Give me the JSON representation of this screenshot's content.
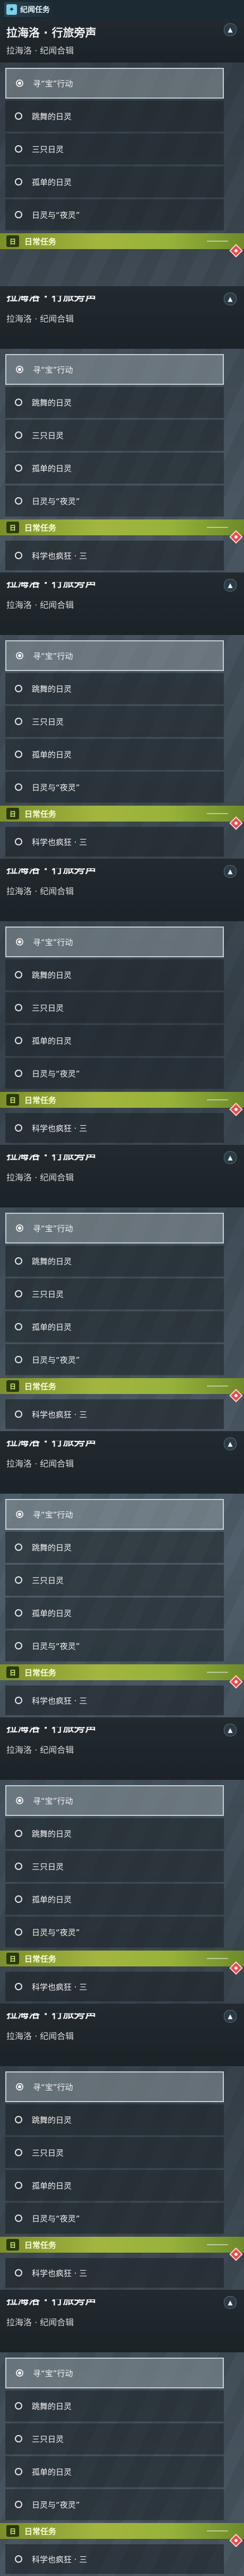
{
  "category": {
    "label": "纪闻任务"
  },
  "quest": {
    "title": "拉海洛 · 行旅旁声",
    "subtitle": "拉海洛 · 纪闻合辑"
  },
  "steps": [
    {
      "label": "寻“宝”行动",
      "active": true
    },
    {
      "label": "跳舞的日灵",
      "active": false
    },
    {
      "label": "三只日灵",
      "active": false
    },
    {
      "label": "孤单的日灵",
      "active": false
    },
    {
      "label": "日灵与“夜灵”",
      "active": false
    }
  ],
  "daily": {
    "label": "日常任务",
    "item": "科学也疯狂 · 三"
  },
  "icons": {
    "category": "plus-icon",
    "collapse": "chevron-up-icon",
    "daily": "daily-icon",
    "alert": "alert-diamond-icon"
  },
  "colors": {
    "topbar": "#1c2a33",
    "category_icon": "#7ed0e8",
    "daily_bar": "#a3b63f",
    "alert": "#e24e4e"
  }
}
